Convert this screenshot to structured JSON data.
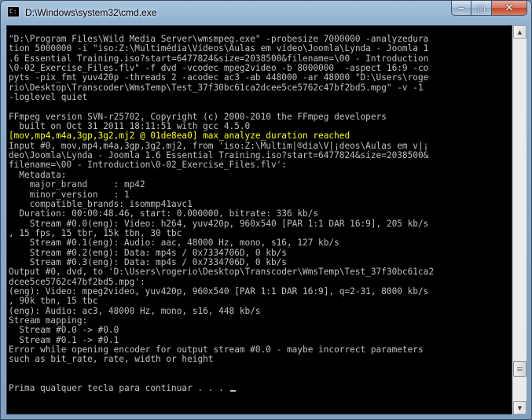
{
  "window": {
    "title": "D:\\Windows\\system32\\cmd.exe",
    "icon": "cmd-icon",
    "controls": {
      "minimize": "‒",
      "maximize": "□",
      "close": "✕"
    }
  },
  "console": {
    "lines": [
      "\"D:\\Program Files\\Wild Media Server\\wmsmpeg.exe\" -probesize 7000000 -analyzedura",
      "tion 5000000 -i \"iso:Z:\\Multimédia\\Vídeos\\Aulas em vídeo\\Joomla\\Lynda - Joomla 1",
      ".6 Essential Training.iso?start=6477824&size=2038500&filename=\\00 - Introduction",
      "\\0-02_Exercise_Files.flv\" -f dvd -vcodec mpeg2video -b 8000000  -aspect 16:9 -co",
      "pyts -pix_fmt yuv420p -threads 2 -acodec ac3 -ab 448000 -ar 48000 \"D:\\Users\\roge",
      "rio\\Desktop\\Transcoder\\WmsTemp\\Test_37f30bc61ca2dcee5ce5762c47bf2bd5.mpg\" -v -1",
      "-loglevel quiet",
      "",
      "FFmpeg version SVN-r25702, Copyright (c) 2000-2010 the FFmpeg developers",
      "  built on Oct 31 2011 18:11:51 with gcc 4.5.0",
      "[mov,mp4,m4a,3gp,3g2,mj2 @ 01de8ea0] max_analyze_duration reached",
      "Input #0, mov,mp4,m4a,3gp,3g2,mj2, from 'iso:Z:\\Multim|®dia\\V|¡deos\\Aulas em v|¡",
      "deo\\Joomla\\Lynda - Joomla 1.6 Essential Training.iso?start=6477824&size=2038500&",
      "filename=\\00 - Introduction\\0-02_Exercise_Files.flv':",
      "  Metadata:",
      "    major_brand     : mp42",
      "    minor_version   : 1",
      "    compatible_brands: isommp41avc1",
      "  Duration: 00:00:48.46, start: 0.000000, bitrate: 336 kb/s",
      "    Stream #0.0(eng): Video: h264, yuv420p, 960x540 [PAR 1:1 DAR 16:9], 205 kb/s",
      ", 15 fps, 15 tbr, 15k tbn, 30 tbc",
      "    Stream #0.1(eng): Audio: aac, 48000 Hz, mono, s16, 127 kb/s",
      "    Stream #0.2(eng): Data: mp4s / 0x7334706D, 0 kb/s",
      "    Stream #0.3(eng): Data: mp4s / 0x7334706D, 0 kb/s",
      "Output #0, dvd, to 'D:\\Users\\rogerio\\Desktop\\Transcoder\\WmsTemp\\Test_37f30bc61ca2",
      "dcee5ce5762c47bf2bd5.mpg':",
      "(eng): Video: mpeg2video, yuv420p, 960x540 [PAR 1:1 DAR 16:9], q=2-31, 8000 kb/s",
      ", 90k tbn, 15 tbc",
      "(eng): Audio: ac3, 48000 Hz, mono, s16, 448 kb/s",
      "Stream mapping:",
      "  Stream #0.0 -> #0.0",
      "  Stream #0.1 -> #0.1",
      "Error while opening encoder for output stream #0.0 - maybe incorrect parameters",
      "such as bit_rate, rate, width or height",
      "",
      "",
      "Prima qualquer tecla para continuar . . . "
    ],
    "highlight_line_index": 10,
    "highlight_color": "#ffff00",
    "text_color": "#c0c0c0",
    "background_color": "#000000"
  },
  "scrollbar": {
    "up_arrow": "▲",
    "down_arrow": "▼",
    "thumb_position": 0.93
  }
}
